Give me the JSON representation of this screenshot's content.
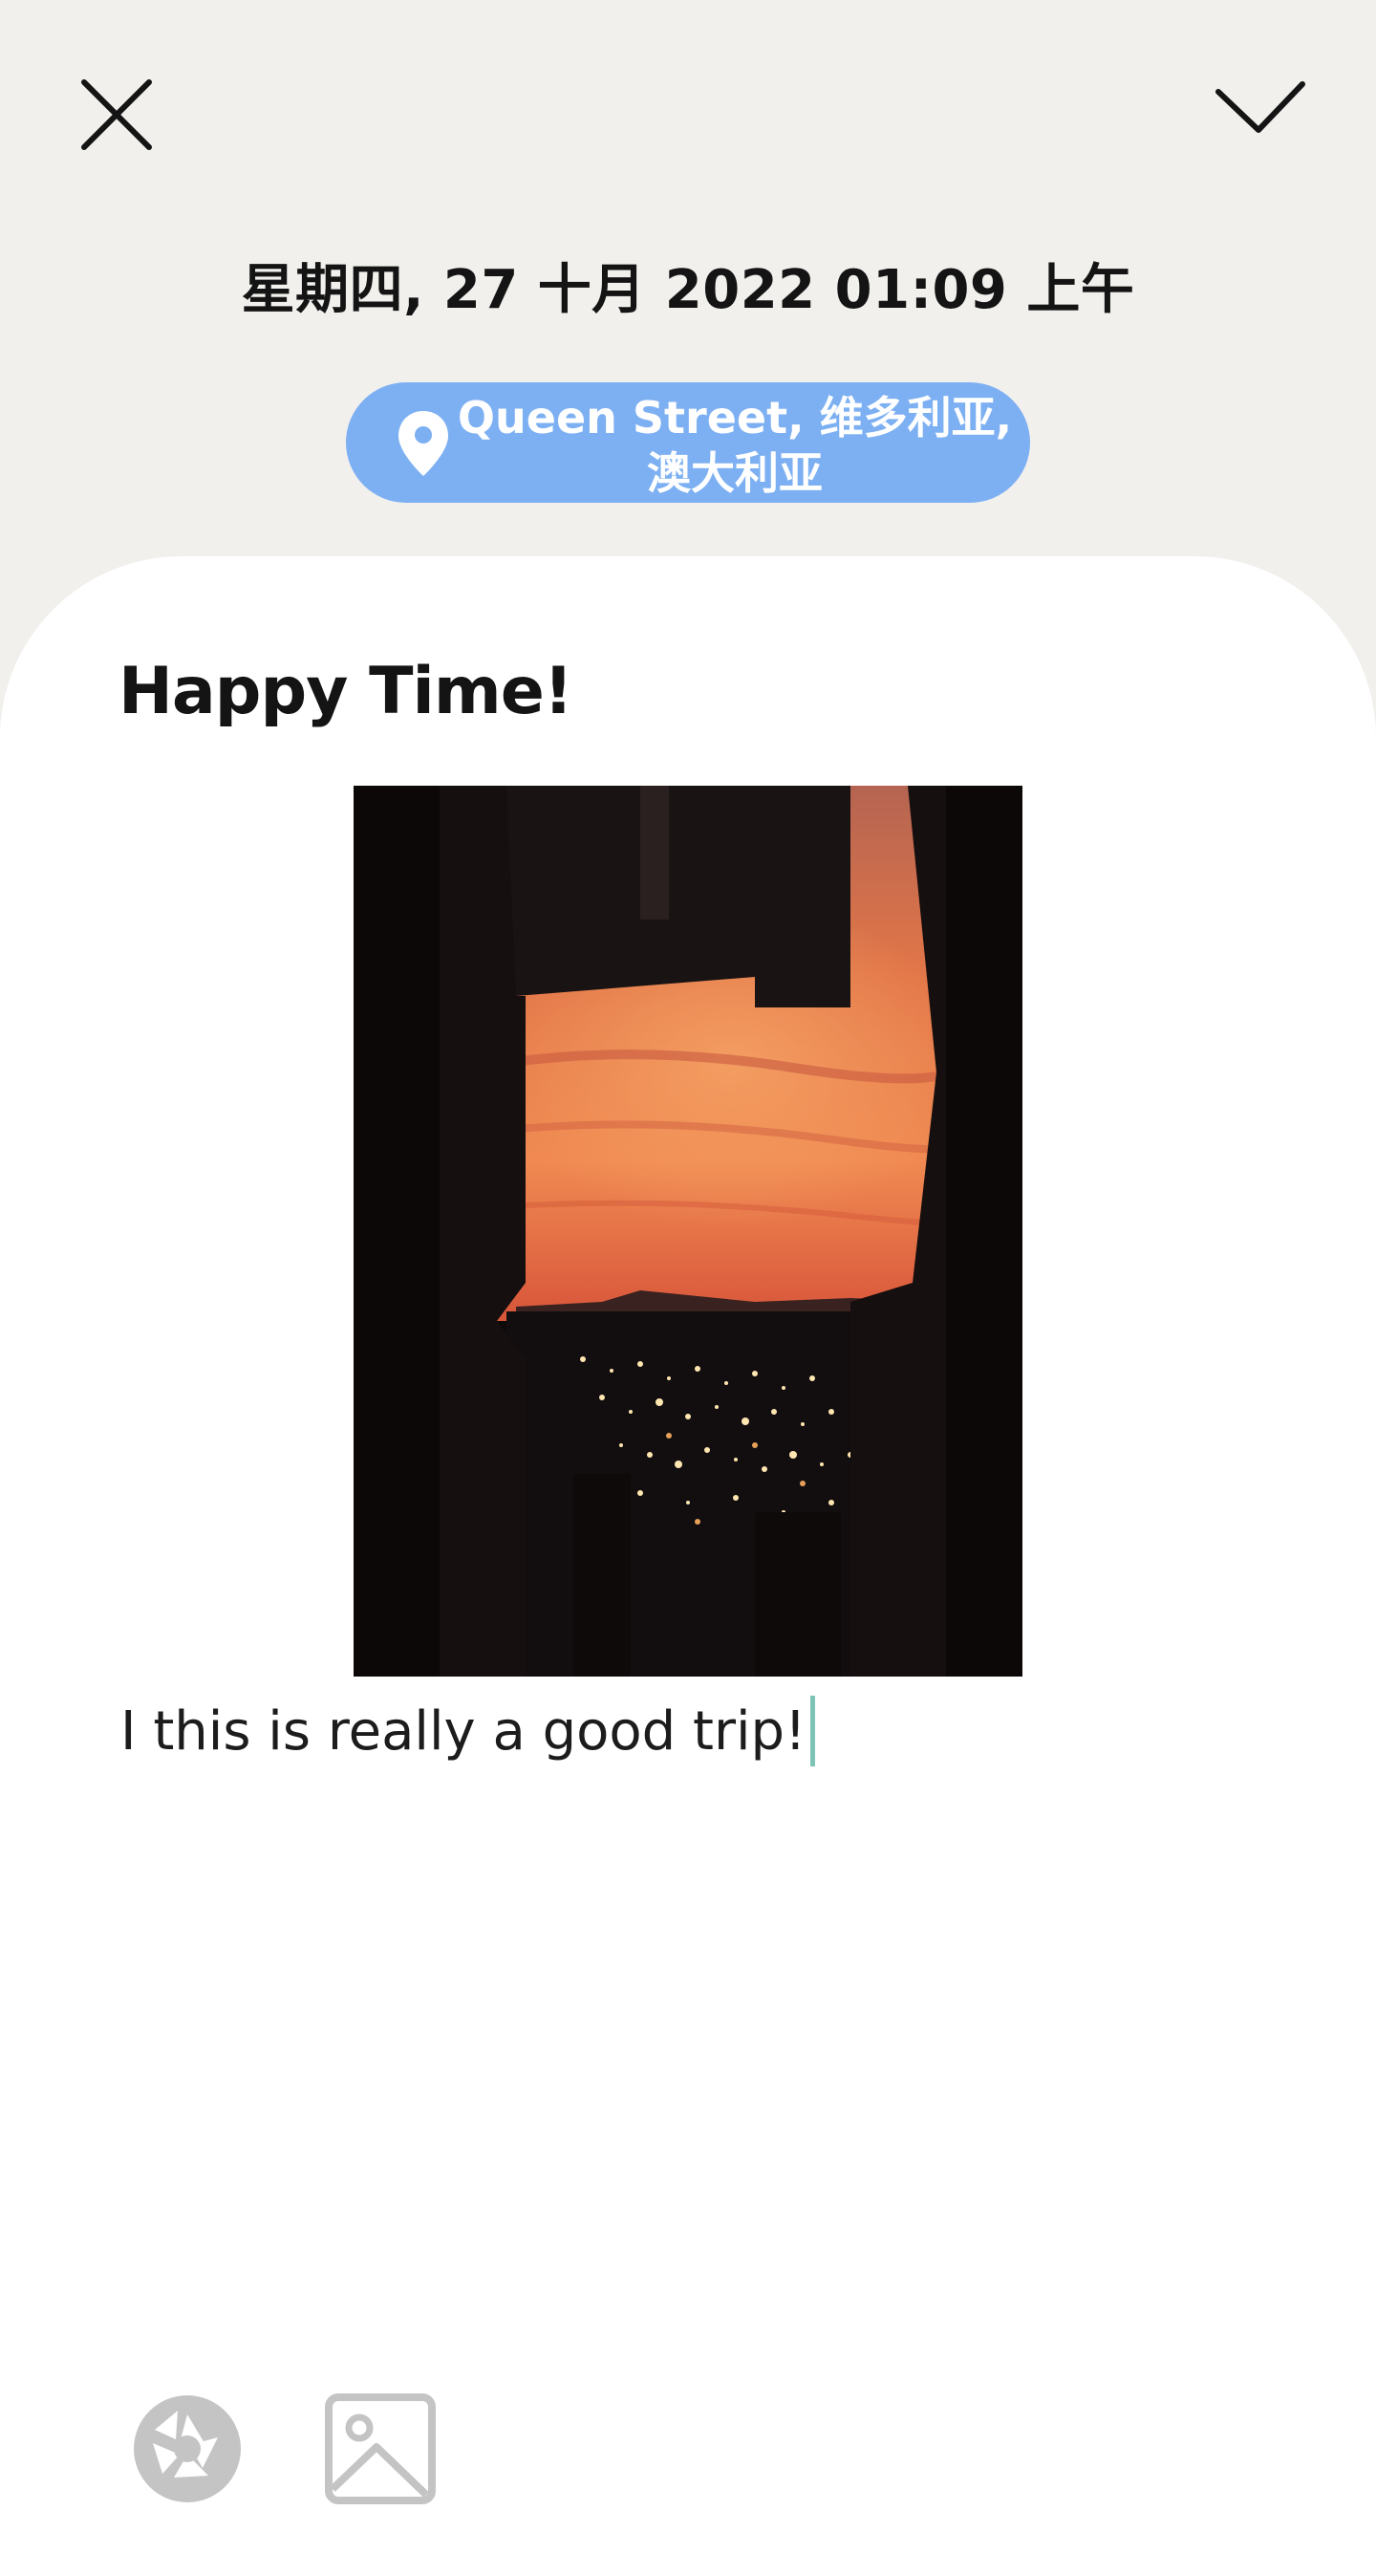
{
  "header": {
    "close_icon": "close-icon",
    "confirm_icon": "check-icon",
    "date": "星期四, 27 十月 2022 01:09 上午"
  },
  "location": {
    "icon": "map-pin-icon",
    "line1": "Queen Street, 维多利亚,",
    "line2": "澳大利亚",
    "chip_color": "#7db0f2"
  },
  "entry": {
    "title": "Happy Time!",
    "photo_description_icon": "photo",
    "body": "I this is really a good trip!"
  },
  "toolbar": {
    "camera_icon": "camera-shutter-icon",
    "gallery_icon": "image-icon"
  },
  "colors": {
    "background": "#f2f0ed",
    "card": "#ffffff",
    "caret": "#7fc2b6",
    "toolbar_icon": "#c4c4c4"
  }
}
